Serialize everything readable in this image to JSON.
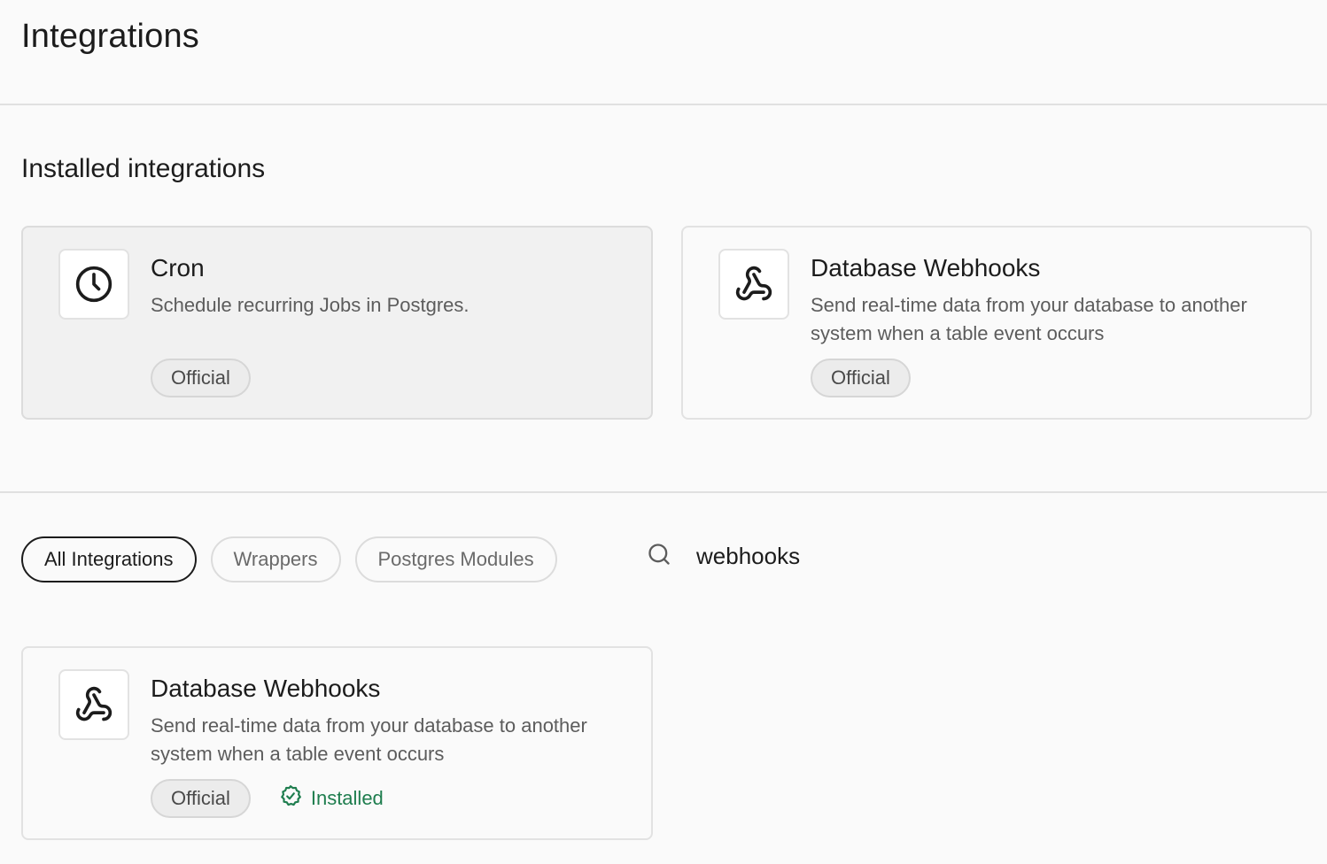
{
  "header": {
    "title": "Integrations"
  },
  "installed": {
    "title": "Installed integrations",
    "cards": [
      {
        "name": "Cron",
        "description": "Schedule recurring Jobs in Postgres.",
        "badge": "Official",
        "icon": "clock-icon"
      },
      {
        "name": "Database Webhooks",
        "description": "Send real-time data from your database to another system when a table event occurs",
        "badge": "Official",
        "icon": "webhook-icon"
      }
    ]
  },
  "filters": {
    "tabs": [
      {
        "label": "All Integrations",
        "active": true
      },
      {
        "label": "Wrappers",
        "active": false
      },
      {
        "label": "Postgres Modules",
        "active": false
      }
    ],
    "search": {
      "value": "webhooks",
      "icon": "search-icon"
    }
  },
  "results": [
    {
      "name": "Database Webhooks",
      "description": "Send real-time data from your database to another system when a table event occurs",
      "badge": "Official",
      "status": "Installed",
      "icon": "webhook-icon"
    }
  ],
  "colors": {
    "installed_green": "#1e7d4e",
    "active_border": "#1c1c1c"
  }
}
